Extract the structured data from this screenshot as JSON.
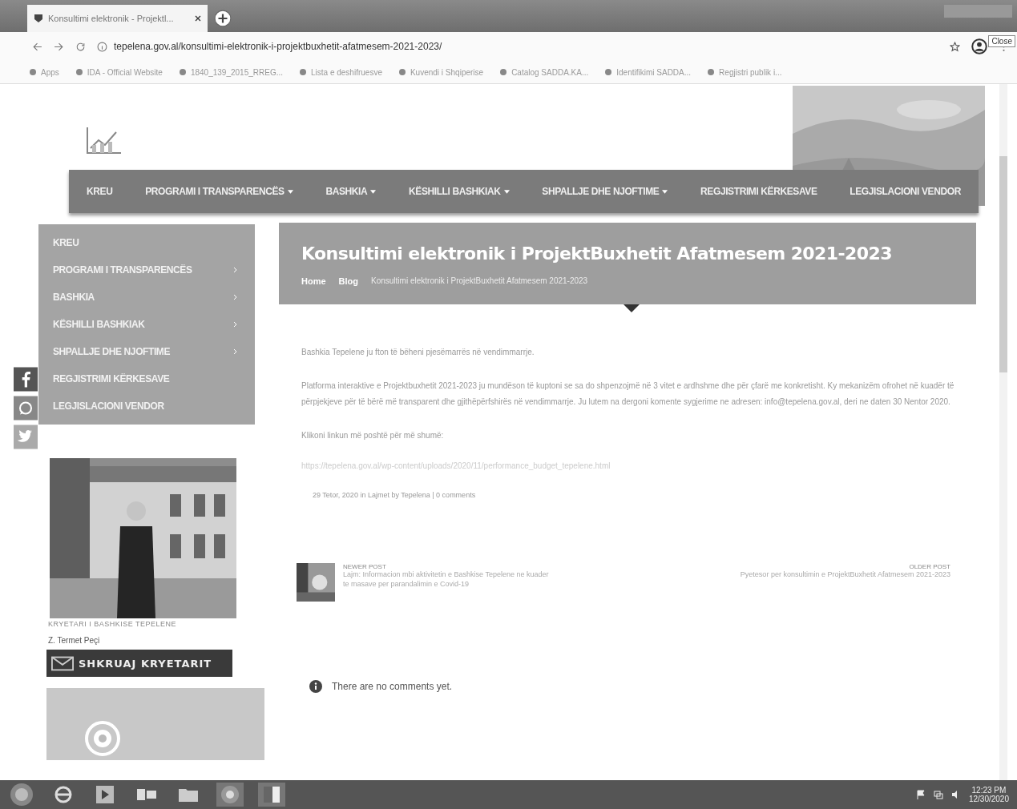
{
  "browser": {
    "tab_title": "Konsultimi elektronik - Projektl...",
    "url": "tepelena.gov.al/konsultimi-elektronik-i-projektbuxhetit-afatmesem-2021-2023/",
    "tooltip": "Close",
    "bookmarks": [
      "Apps",
      "IDA - Official Website",
      "1840_139_2015_RREG...",
      "Lista e deshifruesve",
      "Kuvendi i Shqiperise",
      "Catalog SADDA.KA...",
      "Identifikimi SADDA...",
      "Regjistri publik i..."
    ]
  },
  "nav": [
    {
      "label": "KREU",
      "dropdown": false
    },
    {
      "label": "PROGRAMI I TRANSPARENCËS",
      "dropdown": true
    },
    {
      "label": "BASHKIA",
      "dropdown": true
    },
    {
      "label": "KËSHILLI BASHKIAK",
      "dropdown": true
    },
    {
      "label": "SHPALLJE DHE NJOFTIME",
      "dropdown": true
    },
    {
      "label": "REGJISTRIMI KËRKESAVE",
      "dropdown": false
    },
    {
      "label": "LEGJISLACIONI VENDOR",
      "dropdown": false
    }
  ],
  "sidebar_menu": [
    {
      "label": "KREU",
      "submenu": false
    },
    {
      "label": "PROGRAMI I TRANSPARENCËS",
      "submenu": true
    },
    {
      "label": "BASHKIA",
      "submenu": true
    },
    {
      "label": "KËSHILLI BASHKIAK",
      "submenu": true
    },
    {
      "label": "SHPALLJE DHE NJOFTIME",
      "submenu": true
    },
    {
      "label": "REGJISTRIMI KËRKESAVE",
      "submenu": false
    },
    {
      "label": "LEGJISLACIONI VENDOR",
      "submenu": false
    }
  ],
  "mayor": {
    "caption": "KRYETARI I BASHKISE TEPELENE",
    "name": "Z. Termet Peçi",
    "button": "SHKRUAJ KRYETARIT"
  },
  "post": {
    "title": "Konsultimi elektronik i ProjektBuxhetit Afatmesem 2021-2023",
    "breadcrumb": [
      "Home",
      "Blog",
      "Konsultimi elektronik i ProjektBuxhetit Afatmesem 2021-2023"
    ],
    "paragraphs": [
      "Bashkia Tepelene ju fton të bëheni pjesëmarrës në vendimmarrje.",
      "Platforma interaktive e Projektbuxhetit 2021-2023 ju mundëson të kuptoni se sa do shpenzojmë në 3 vitet e ardhshme dhe për çfarë me konkretisht. Ky mekanizëm ofrohet në kuadër të përpjekjeve për të bërë më transparent dhe gjithëpërfshirës në vendimmarrje. Ju lutem na dergoni komente sygjerime ne adresen: info@tepelena.gov.al, deri ne daten 30 Nentor 2020.",
      "Klikoni linkun më poshtë për më shumë:"
    ],
    "link": "https://tepelena.gov.al/wp-content/uploads/2020/11/performance_budget_tepelene.html",
    "meta": "29 Tetor, 2020 in Lajmet by Tepelena | 0 comments"
  },
  "post_nav": {
    "newer": {
      "label": "NEWER POST",
      "title": "Lajm: Informacion mbi aktivitetin e Bashkise Tepelene ne kuader te masave per parandalimin e Covid-19"
    },
    "older": {
      "label": "OLDER POST",
      "title": "Pyetesor per konsultimin e ProjektBuxhetit Afatmesem 2021-2023"
    }
  },
  "comments": {
    "message": "There are no comments yet."
  },
  "taskbar": {
    "time": "12:23 PM",
    "date": "12/30/2020"
  }
}
